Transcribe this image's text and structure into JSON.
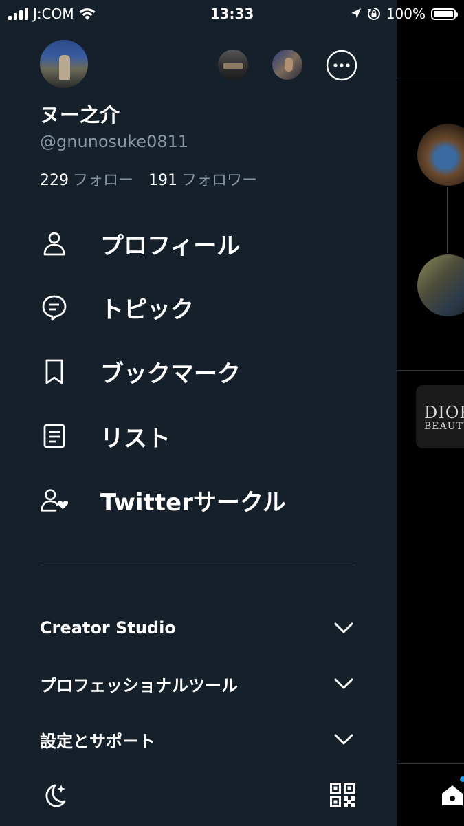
{
  "status_bar": {
    "carrier": "J:COM",
    "time": "13:33",
    "battery": "100%"
  },
  "profile": {
    "name": "ヌー之介",
    "handle": "@gnunosuke0811",
    "following_count": "229",
    "following_label": "フォロー",
    "followers_count": "191",
    "followers_label": "フォロワー"
  },
  "menu": {
    "items": [
      {
        "label": "プロフィール",
        "icon": "person-icon"
      },
      {
        "label": "トピック",
        "icon": "topics-icon"
      },
      {
        "label": "ブックマーク",
        "icon": "bookmark-icon"
      },
      {
        "label": "リスト",
        "icon": "lists-icon"
      },
      {
        "label": "Twitterサークル",
        "icon": "circle-icon"
      }
    ]
  },
  "sections": [
    {
      "label": "Creator Studio"
    },
    {
      "label": "プロフェッショナルツール"
    },
    {
      "label": "設定とサポート"
    }
  ],
  "background": {
    "ad_line1": "DIOR",
    "ad_line2": "BEAUTY"
  },
  "colors": {
    "drawer_bg": "#15202b",
    "secondary_text": "#8899a6",
    "accent": "#1d9bf0"
  }
}
